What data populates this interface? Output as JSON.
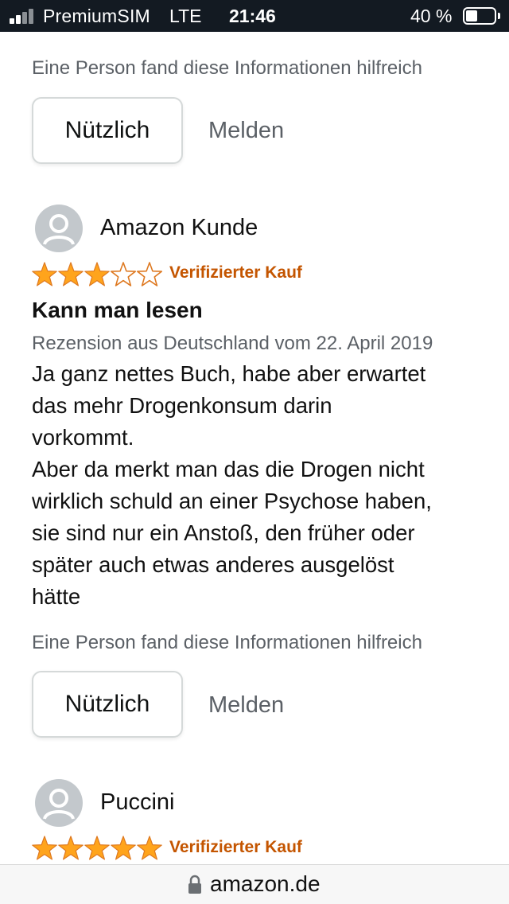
{
  "status_bar": {
    "carrier": "PremiumSIM",
    "network": "LTE",
    "time": "21:46",
    "battery_percent_text": "40 %",
    "battery_level": 0.4
  },
  "review_prev": {
    "helpful_count_text": "Eine Person fand diese Informationen hilfreich",
    "useful_label": "Nützlich",
    "report_label": "Melden"
  },
  "review_1": {
    "reviewer": "Amazon Kunde",
    "rating": 3,
    "max_rating": 5,
    "verified_label": "Verifizierter Kauf",
    "title": "Kann man lesen",
    "date_text": "Rezension aus Deutschland vom 22. April 2019",
    "body_lines": [
      "Ja ganz nettes Buch, habe aber erwartet",
      "das mehr Drogenkonsum darin",
      "vorkommt.",
      "Aber da merkt man das die Drogen nicht",
      "wirklich schuld an einer Psychose haben,",
      "sie sind nur ein Anstoß, den früher oder",
      "später auch etwas anderes ausgelöst",
      "hätte"
    ],
    "helpful_count_text": "Eine Person fand diese Informationen hilfreich",
    "useful_label": "Nützlich",
    "report_label": "Melden"
  },
  "review_2": {
    "reviewer": "Puccini",
    "rating": 5,
    "max_rating": 5,
    "verified_label": "Verifizierter Kauf"
  },
  "url_bar": {
    "url": "amazon.de",
    "icon": "lock-icon"
  },
  "colors": {
    "status_bar_bg": "#131a22",
    "star_fill": "#ffa41c",
    "star_outline": "#de7921",
    "verified": "#c45500",
    "secondary_text": "#5b6066"
  }
}
